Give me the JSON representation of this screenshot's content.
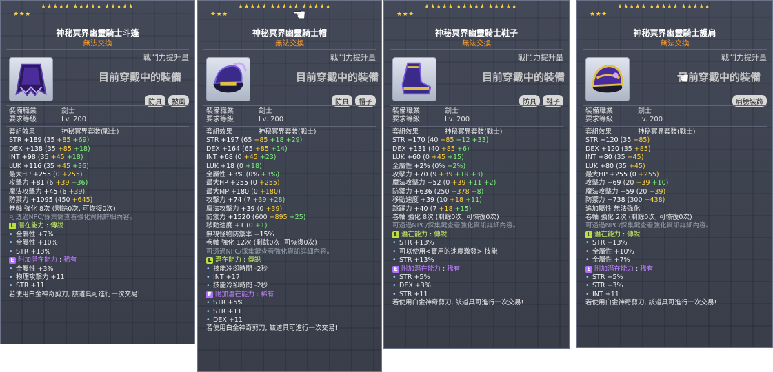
{
  "panels": [
    {
      "stars_on": "★★★★★ ★★★★★ ★★★★★",
      "stars_row2": "★★★",
      "title": "神秘冥界幽靈騎士斗篷",
      "untradeable": "無法交換",
      "combat": "戰鬥力提升量",
      "equipped": "目前穿戴中的裝備",
      "tags": [
        "防具",
        "披風"
      ],
      "job_label": "裝備職業",
      "job": "劍士",
      "req_label": "要求等級",
      "req": "Lv. 200",
      "set_label": "套組效果",
      "set_name": "神秘冥界套裝(戰士)",
      "stats": [
        {
          "n": "STR",
          "v": "+189",
          "b": "(35",
          "y": "+85",
          "g": "+69)"
        },
        {
          "n": "DEX",
          "v": "+138",
          "b": "(35",
          "y": "+85",
          "g": "+18)"
        },
        {
          "n": "INT",
          "v": "+98",
          "b": "(35",
          "y": "+45",
          "g": "+18)"
        },
        {
          "n": "LUK",
          "v": "+116",
          "b": "(35",
          "y": "+45",
          "g": "+36)"
        },
        {
          "n": "最大HP",
          "v": "+255",
          "b": "(0",
          "y": "+255)",
          "g": ""
        },
        {
          "n": "攻擊力",
          "v": "+81",
          "b": "(6",
          "y": "+39",
          "g": "+36)"
        },
        {
          "n": "魔法攻擊力",
          "v": "+45",
          "b": "(6",
          "y": "+39)",
          "g": ""
        },
        {
          "n": "防禦力",
          "v": "+1095",
          "b": "(450",
          "y": "+645)",
          "g": ""
        }
      ],
      "extra": [],
      "scroll": "卷軸 強化 8次 (剩餘0次, 可恢復0次)",
      "hint": "可透過NPC/採集鍵查看強化資訊詳細內容。",
      "pot_label": "潛在能力",
      "pot_grade": "傳說",
      "pot_lines": [
        "全屬性 +7%",
        "全屬性 +10%",
        "STR +13%"
      ],
      "add_label": "附加潛在能力",
      "add_grade": "稀有",
      "add_lines": [
        "全屬性 +3%",
        "物理攻擊力 +11",
        "STR +11"
      ],
      "footer": "若使用白金神奇剪刀, 該道具可進行一次交易!"
    },
    {
      "stars_on": "★★★★★ ★★★★★ ★★★★★",
      "stars_row2": "★★★",
      "title": "神秘冥界幽靈騎士帽",
      "untradeable": "無法交換",
      "combat": "戰鬥力提升量",
      "equipped": "目前穿戴中的裝備",
      "tags": [
        "防具",
        "帽子"
      ],
      "job_label": "裝備職業",
      "job": "劍士",
      "req_label": "要求等級",
      "req": "Lv. 200",
      "set_label": "套組效果",
      "set_name": "神秘冥界套裝(戰士)",
      "stats": [
        {
          "n": "STR",
          "v": "+197",
          "b": "(65",
          "y": "+85",
          "g": "+18 +29)"
        },
        {
          "n": "DEX",
          "v": "+164",
          "b": "(65",
          "y": "+85",
          "g": "+14)"
        },
        {
          "n": "INT",
          "v": "+68",
          "b": "(0",
          "y": "+45",
          "g": "+23)"
        },
        {
          "n": "LUK",
          "v": "+18",
          "b": "(0",
          "y": "",
          "g": "+18)"
        },
        {
          "n": "全屬性",
          "v": "+3%",
          "b": "(0%",
          "y": "",
          "g": "+3%)"
        },
        {
          "n": "最大HP",
          "v": "+255",
          "b": "(0",
          "y": "+255)",
          "g": ""
        },
        {
          "n": "最大MP",
          "v": "+180",
          "b": "(0",
          "y": "+180)",
          "g": ""
        },
        {
          "n": "攻擊力",
          "v": "+74",
          "b": "(7",
          "y": "+39",
          "g": "+28)"
        },
        {
          "n": "魔法攻擊力",
          "v": "+39",
          "b": "(0",
          "y": "+39)",
          "g": ""
        },
        {
          "n": "防禦力",
          "v": "+1520",
          "b": "(600",
          "y": "+895",
          "g": "+25)"
        },
        {
          "n": "移動速度",
          "v": "+1",
          "b": "(0",
          "y": "",
          "g": "+1)"
        },
        {
          "n": "無視怪物防禦率",
          "v": "+15%",
          "b": "",
          "y": "",
          "g": ""
        }
      ],
      "extra": [],
      "scroll": "卷軸 強化 12次 (剩餘0次, 可恢復0次)",
      "hint": "可透過NPC/採集鍵查看強化資訊詳細內容。",
      "pot_label": "潛在能力",
      "pot_grade": "傳說",
      "pot_lines": [
        "技能冷卻時間 -2秒",
        "INT +17",
        "技能冷卻時間 -2秒"
      ],
      "add_label": "附加潛在能力",
      "add_grade": "稀有",
      "add_lines": [
        "STR +5%",
        "STR +11",
        "DEX +11"
      ],
      "footer": "若使用白金神奇剪刀, 該道具可進行一次交易!"
    },
    {
      "stars_on": "★★★★★ ★★★★★ ★★★★★",
      "stars_row2": "★★★",
      "title": "神秘冥界幽靈騎士鞋子",
      "untradeable": "無法交換",
      "combat": "戰鬥力提升量",
      "equipped": "目前穿戴中的裝備",
      "tags": [
        "防具",
        "鞋子"
      ],
      "job_label": "裝備職業",
      "job": "劍士",
      "req_label": "要求等級",
      "req": "Lv. 200",
      "set_label": "套組效果",
      "set_name": "神秘冥界套裝(戰士)",
      "stats": [
        {
          "n": "STR",
          "v": "+170",
          "b": "(40",
          "y": "+85",
          "g": "+12 +33)"
        },
        {
          "n": "DEX",
          "v": "+131",
          "b": "(40",
          "y": "+85",
          "g": "+6)"
        },
        {
          "n": "LUK",
          "v": "+60",
          "b": "(0",
          "y": "+45",
          "g": "+15)"
        },
        {
          "n": "全屬性",
          "v": "+2%",
          "b": "(0%",
          "y": "",
          "g": "+2%)"
        },
        {
          "n": "攻擊力",
          "v": "+70",
          "b": "(9",
          "y": "+39",
          "g": "+19 +3)"
        },
        {
          "n": "魔法攻擊力",
          "v": "+52",
          "b": "(0",
          "y": "+39",
          "g": "+11 +2)"
        },
        {
          "n": "防禦力",
          "v": "+636",
          "b": "(250",
          "y": "+378",
          "g": "+8)"
        },
        {
          "n": "移動速度",
          "v": "+39",
          "b": "(10",
          "y": "+18",
          "g": "+11)"
        },
        {
          "n": "跳躍力",
          "v": "+40",
          "b": "(7",
          "y": "+18",
          "g": "+15)"
        }
      ],
      "extra": [],
      "scroll": "卷軸 強化 8次 (剩餘0次, 可恢復0次)",
      "hint": "可透過NPC/採集鍵查看強化資訊詳細內容。",
      "pot_label": "潛在能力",
      "pot_grade": "傳說",
      "pot_lines": [
        "STR +13%",
        "可以使用<寶用的速度激發> 技能",
        "STR +13%"
      ],
      "add_label": "附加潛在能力",
      "add_grade": "稀有",
      "add_lines": [
        "STR +5%",
        "DEX +3%",
        "STR +11"
      ],
      "footer": "若使用白金神奇剪刀, 該道具可進行一次交易!"
    },
    {
      "stars_on": "★★★★★ ★★★★★ ★★★★★",
      "stars_row2": "★★★",
      "title": "神秘冥界幽靈騎士護肩",
      "untradeable": "無法交換",
      "combat": "戰鬥力提升量",
      "equipped": "目前穿戴中的裝備",
      "tags": [
        "肩膀裝飾"
      ],
      "job_label": "裝備職業",
      "job": "劍士",
      "req_label": "要求等級",
      "req": "Lv. 200",
      "set_label": "套組效果",
      "set_name": "神秘冥界套裝(戰士)",
      "stats": [
        {
          "n": "STR",
          "v": "+120",
          "b": "(35",
          "y": "+85)",
          "g": ""
        },
        {
          "n": "DEX",
          "v": "+120",
          "b": "(35",
          "y": "+85)",
          "g": ""
        },
        {
          "n": "INT",
          "v": "+80",
          "b": "(35",
          "y": "+45)",
          "g": ""
        },
        {
          "n": "LUK",
          "v": "+80",
          "b": "(35",
          "y": "+45)",
          "g": ""
        },
        {
          "n": "最大HP",
          "v": "+255",
          "b": "(0",
          "y": "+255)",
          "g": ""
        },
        {
          "n": "攻擊力",
          "v": "+69",
          "b": "(20",
          "y": "+39",
          "g": "+10)"
        },
        {
          "n": "魔法攻擊力",
          "v": "+59",
          "b": "(20",
          "y": "+39)",
          "g": ""
        },
        {
          "n": "防禦力",
          "v": "+738",
          "b": "(300",
          "y": "+438)",
          "g": ""
        }
      ],
      "extra": [
        "追加屬性 無法強化"
      ],
      "scroll": "卷軸 強化 2次 (剩餘0次, 可恢復0次)",
      "hint": "可透過NPC/採集鍵查看強化資訊詳細內容。",
      "pot_label": "潛在能力",
      "pot_grade": "傳說",
      "pot_lines": [
        "STR +13%",
        "全屬性 +10%",
        "全屬性 +7%"
      ],
      "add_label": "附加潛在能力",
      "add_grade": "稀有",
      "add_lines": [
        "STR +5%",
        "STR +3%",
        "INT +11"
      ],
      "footer": "若使用白金神奇剪刀, 該道具可進行一次交易!"
    }
  ],
  "badges": {
    "legend": "L",
    "epic": "E"
  },
  "colors": {
    "gold": "#ffd23c",
    "orange": "#ff9d2a",
    "green": "#7ef37a",
    "legend": "#b8e040",
    "epic": "#b070ff"
  }
}
